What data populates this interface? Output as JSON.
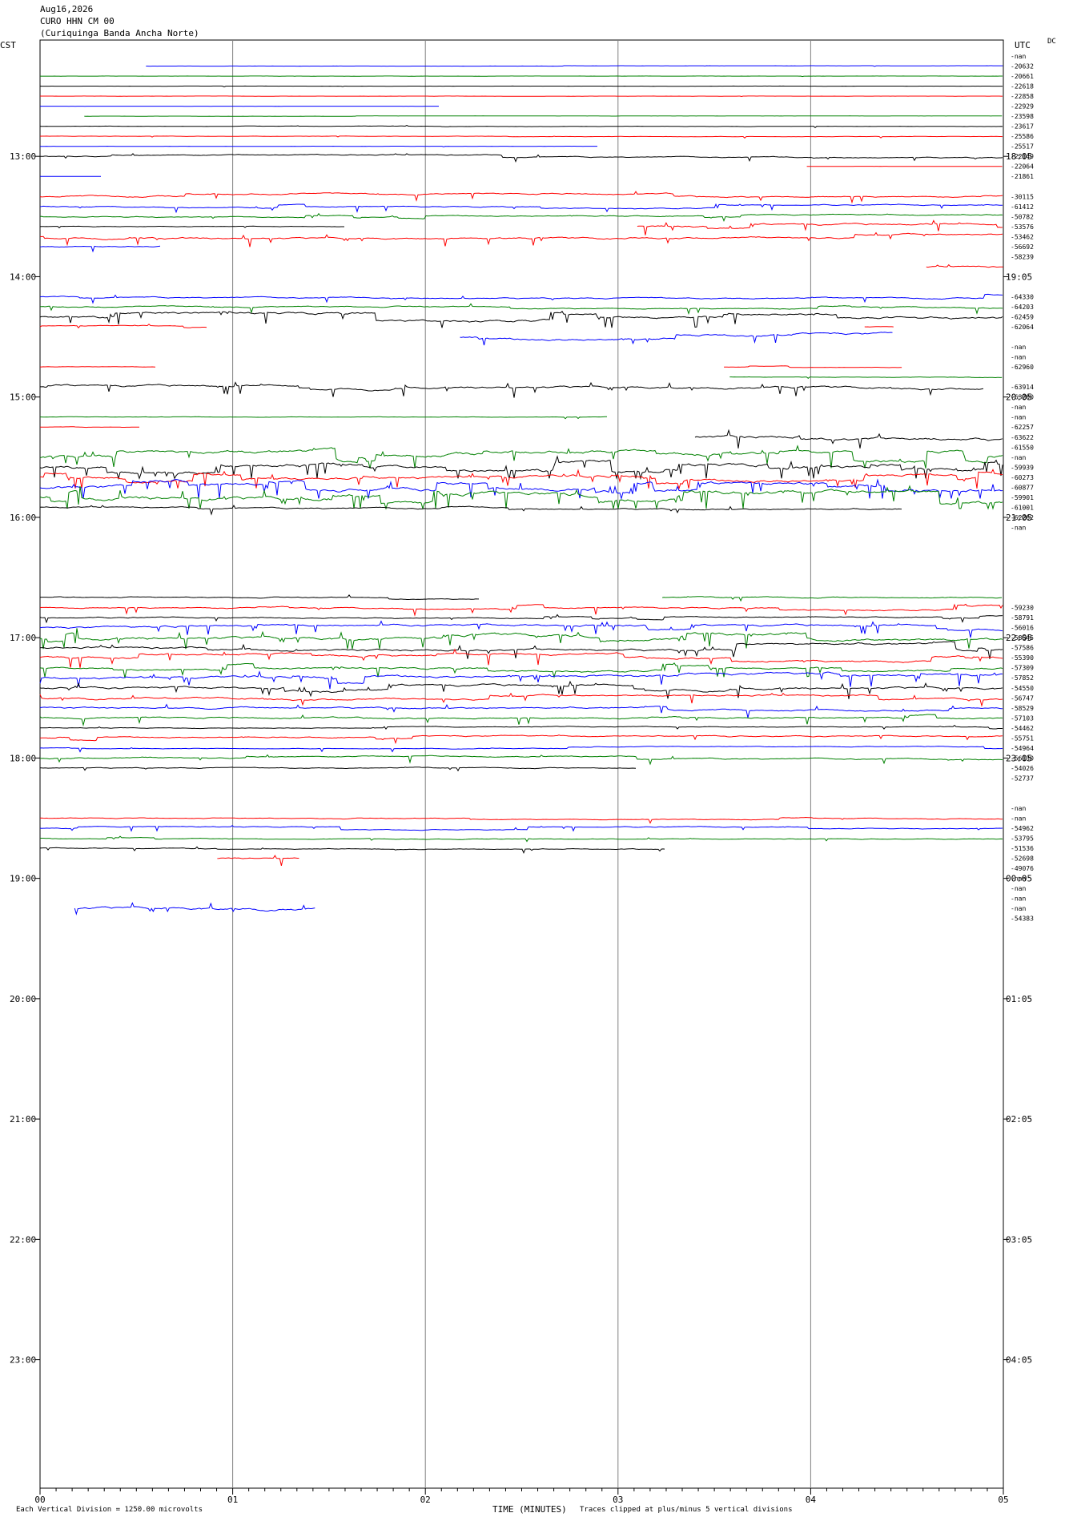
{
  "header": {
    "date": "Aug16,2026",
    "station": "CURO HHN CM 00",
    "site": "(Curiquinga Banda Ancha Norte)"
  },
  "corner_left": "CST",
  "corner_right": "UTC",
  "dc_label": "DC",
  "footer": {
    "x_axis_title": "TIME (MINUTES)",
    "scale_note": "Each Vertical Division = 1250.00 microvolts",
    "clip_note": "Traces clipped at plus/minus 5 vertical divisions"
  },
  "chart_data": {
    "type": "line",
    "title": "",
    "xlabel": "TIME (MINUTES)",
    "xlim": [
      0,
      5
    ],
    "x_ticks": [
      "00",
      "01",
      "02",
      "03",
      "04",
      "05"
    ],
    "left_time_labels": [
      "13:00",
      "14:00",
      "15:00",
      "16:00",
      "17:00",
      "18:00",
      "19:00",
      "20:00",
      "21:00",
      "22:00",
      "23:00"
    ],
    "right_time_labels": [
      "18:05",
      "19:05",
      "20:05",
      "21:05",
      "22:05",
      "23:05",
      "00:05",
      "01:05",
      "02:05",
      "03:05",
      "04:05"
    ],
    "grid": true,
    "trace_colors": [
      "#000000",
      "#ff0000",
      "#0000ff",
      "#008000"
    ],
    "dc_offsets": [
      "-nan",
      "-20632",
      "-20661",
      "-22618",
      "-22858",
      "-22929",
      "-23598",
      "-23617",
      "-25586",
      "-25517",
      "-22149",
      "-22064",
      "-21861",
      "",
      "-30115",
      "-61412",
      "-50782",
      "-53576",
      "-53462",
      "-56692",
      "-58239",
      "",
      "",
      "",
      "-64330",
      "-64203",
      "-62459",
      "-62064",
      "",
      "-nan",
      "-nan",
      "-62960",
      "",
      "-63914",
      "-63200",
      "-nan",
      "-nan",
      "-62257",
      "-63622",
      "-61550",
      "-nan",
      "-59939",
      "-60273",
      "-60877",
      "-59901",
      "-61001",
      "-62262",
      "-nan",
      "",
      "",
      "",
      "",
      "",
      "",
      "",
      "-59230",
      "-58791",
      "-56016",
      "-58545",
      "-57586",
      "-55390",
      "-57309",
      "-57852",
      "-54550",
      "-56747",
      "-58529",
      "-57103",
      "-54462",
      "-55751",
      "-54964",
      "-56130",
      "-54026",
      "-52737",
      "",
      "",
      "-nan",
      "-nan",
      "-54962",
      "-53795",
      "-51536",
      "-52698",
      "-49076",
      "-nan",
      "-nan",
      "-nan",
      "-nan",
      "-54383"
    ],
    "traces": [
      {
        "line": 1,
        "color": "#0000ff",
        "start": 0.55,
        "end": 5.0,
        "level": 0,
        "noise": 0.1
      },
      {
        "line": 2,
        "color": "#008000",
        "start": 0.0,
        "end": 5.0,
        "level": 0,
        "noise": 0.1
      },
      {
        "line": 3,
        "color": "#000000",
        "start": 0.0,
        "end": 5.0,
        "level": 0,
        "noise": 0.1
      },
      {
        "line": 4,
        "color": "#ff0000",
        "start": 0.0,
        "end": 5.0,
        "level": 0,
        "noise": 0.1
      },
      {
        "line": 5,
        "color": "#0000ff",
        "start": 0.0,
        "end": 2.07,
        "level": 0,
        "noise": 0.05
      },
      {
        "line": 6,
        "color": "#008000",
        "start": 0.23,
        "end": 5.0,
        "level": 0,
        "noise": 0.1
      },
      {
        "line": 7,
        "color": "#000000",
        "start": 0.0,
        "end": 5.0,
        "level": 0,
        "noise": 0.2
      },
      {
        "line": 8,
        "color": "#ff0000",
        "start": 0.0,
        "end": 5.0,
        "level": 0,
        "noise": 0.2
      },
      {
        "line": 9,
        "color": "#0000ff",
        "start": 0.0,
        "end": 2.9,
        "level": 0,
        "noise": 0.1
      },
      {
        "line": 10,
        "color": "#000000",
        "start": 0.0,
        "end": 5.0,
        "level": 0,
        "noise": 0.6
      },
      {
        "line": 11,
        "color": "#ff0000",
        "start": 3.98,
        "end": 5.0,
        "level": 0,
        "noise": 0.05
      },
      {
        "line": 12,
        "color": "#0000ff",
        "start": 0.0,
        "end": 0.32,
        "level": 0,
        "noise": 0.05
      },
      {
        "line": 14,
        "color": "#ff0000",
        "start": 0.0,
        "end": 5.0,
        "level": 0,
        "noise": 0.8
      },
      {
        "line": 15,
        "color": "#0000ff",
        "start": 0.0,
        "end": 5.0,
        "level": 0,
        "noise": 0.6
      },
      {
        "line": 16,
        "color": "#008000",
        "start": 0.0,
        "end": 5.0,
        "level": 0,
        "noise": 0.6
      },
      {
        "line": 17,
        "color": "#000000",
        "start": 0.0,
        "end": 1.58,
        "level": 0,
        "noise": 0.3
      },
      {
        "line": 17,
        "color": "#ff0000",
        "start": 3.1,
        "end": 5.0,
        "level": 0,
        "noise": 1.0
      },
      {
        "line": 18,
        "color": "#ff0000",
        "start": 0.0,
        "end": 5.0,
        "level": 0,
        "noise": 0.9
      },
      {
        "line": 19,
        "color": "#0000ff",
        "start": 0.0,
        "end": 0.63,
        "level": 0,
        "noise": 0.6
      },
      {
        "line": 21,
        "color": "#ff0000",
        "start": 4.6,
        "end": 5.0,
        "level": 0,
        "noise": 0.9
      },
      {
        "line": 24,
        "color": "#0000ff",
        "start": 0.0,
        "end": 5.0,
        "level": 0,
        "noise": 0.7
      },
      {
        "line": 25,
        "color": "#008000",
        "start": 0.0,
        "end": 5.0,
        "level": 0,
        "noise": 0.7
      },
      {
        "line": 26,
        "color": "#000000",
        "start": 0.0,
        "end": 5.0,
        "level": 0,
        "noise": 1.3
      },
      {
        "line": 27,
        "color": "#ff0000",
        "start": 0.0,
        "end": 0.87,
        "level": 0,
        "noise": 0.4
      },
      {
        "line": 27,
        "color": "#ff0000",
        "start": 4.28,
        "end": 4.43,
        "level": 0,
        "noise": 0.3
      },
      {
        "line": 28,
        "color": "#0000ff",
        "start": 2.18,
        "end": 4.43,
        "level": 0,
        "noise": 1.2
      },
      {
        "line": 31,
        "color": "#ff0000",
        "start": 0.0,
        "end": 0.6,
        "level": 0,
        "noise": 0.3
      },
      {
        "line": 31,
        "color": "#ff0000",
        "start": 3.55,
        "end": 4.48,
        "level": 0,
        "noise": 0.3
      },
      {
        "line": 32,
        "color": "#008000",
        "start": 3.58,
        "end": 5.0,
        "level": 0,
        "noise": 0.3
      },
      {
        "line": 33,
        "color": "#000000",
        "start": 0.0,
        "end": 4.9,
        "level": 0,
        "noise": 1.1
      },
      {
        "line": 36,
        "color": "#008000",
        "start": 0.0,
        "end": 2.95,
        "level": 0,
        "noise": 0.3
      },
      {
        "line": 37,
        "color": "#ff0000",
        "start": 0.0,
        "end": 0.52,
        "level": 0,
        "noise": 0.3
      },
      {
        "line": 38,
        "color": "#000000",
        "start": 3.4,
        "end": 5.0,
        "level": 0,
        "noise": 1.6
      },
      {
        "line": 40,
        "color": "#008000",
        "start": 0.0,
        "end": 5.0,
        "level": 0,
        "noise": 1.8
      },
      {
        "line": 41,
        "color": "#000000",
        "start": 0.0,
        "end": 5.0,
        "level": 0,
        "noise": 1.8
      },
      {
        "line": 42,
        "color": "#ff0000",
        "start": 0.0,
        "end": 5.0,
        "level": 0,
        "noise": 1.6
      },
      {
        "line": 43,
        "color": "#0000ff",
        "start": 0.0,
        "end": 5.0,
        "level": 0,
        "noise": 1.8
      },
      {
        "line": 44,
        "color": "#008000",
        "start": 0.0,
        "end": 5.0,
        "level": 0,
        "noise": 2.0
      },
      {
        "line": 45,
        "color": "#000000",
        "start": 0.0,
        "end": 4.48,
        "level": 0,
        "noise": 0.8
      },
      {
        "line": 54,
        "color": "#008000",
        "start": 3.23,
        "end": 5.0,
        "level": 0,
        "noise": 0.6
      },
      {
        "line": 54,
        "color": "#000000",
        "start": 0.0,
        "end": 2.28,
        "level": 0,
        "noise": 0.6
      },
      {
        "line": 55,
        "color": "#ff0000",
        "start": 0.0,
        "end": 5.0,
        "level": 0,
        "noise": 0.8
      },
      {
        "line": 56,
        "color": "#000000",
        "start": 0.0,
        "end": 5.0,
        "level": 0,
        "noise": 0.6
      },
      {
        "line": 57,
        "color": "#0000ff",
        "start": 0.0,
        "end": 5.0,
        "level": 0,
        "noise": 1.1
      },
      {
        "line": 58,
        "color": "#008000",
        "start": 0.0,
        "end": 5.0,
        "level": 0,
        "noise": 1.5
      },
      {
        "line": 59,
        "color": "#000000",
        "start": 0.0,
        "end": 5.0,
        "level": 0,
        "noise": 1.2
      },
      {
        "line": 60,
        "color": "#ff0000",
        "start": 0.0,
        "end": 5.0,
        "level": 0,
        "noise": 1.2
      },
      {
        "line": 61,
        "color": "#008000",
        "start": 0.0,
        "end": 5.0,
        "level": 0,
        "noise": 1.1
      },
      {
        "line": 62,
        "color": "#0000ff",
        "start": 0.0,
        "end": 5.0,
        "level": 0,
        "noise": 1.4
      },
      {
        "line": 63,
        "color": "#000000",
        "start": 0.0,
        "end": 5.0,
        "level": 0,
        "noise": 1.2
      },
      {
        "line": 64,
        "color": "#ff0000",
        "start": 0.0,
        "end": 5.0,
        "level": 0,
        "noise": 1.0
      },
      {
        "line": 65,
        "color": "#0000ff",
        "start": 0.0,
        "end": 5.0,
        "level": 0,
        "noise": 0.9
      },
      {
        "line": 66,
        "color": "#008000",
        "start": 0.0,
        "end": 5.0,
        "level": 0,
        "noise": 0.9
      },
      {
        "line": 67,
        "color": "#000000",
        "start": 0.0,
        "end": 5.0,
        "level": 0,
        "noise": 0.4
      },
      {
        "line": 68,
        "color": "#ff0000",
        "start": 0.0,
        "end": 5.0,
        "level": 0,
        "noise": 0.7
      },
      {
        "line": 69,
        "color": "#0000ff",
        "start": 0.0,
        "end": 5.0,
        "level": 0,
        "noise": 0.4
      },
      {
        "line": 70,
        "color": "#008000",
        "start": 0.0,
        "end": 5.0,
        "level": 0,
        "noise": 0.7
      },
      {
        "line": 71,
        "color": "#000000",
        "start": 0.0,
        "end": 3.1,
        "level": 0,
        "noise": 0.5
      },
      {
        "line": 76,
        "color": "#ff0000",
        "start": 0.0,
        "end": 5.0,
        "level": 0,
        "noise": 0.5
      },
      {
        "line": 77,
        "color": "#0000ff",
        "start": 0.0,
        "end": 5.0,
        "level": 0,
        "noise": 0.5
      },
      {
        "line": 78,
        "color": "#008000",
        "start": 0.0,
        "end": 5.0,
        "level": 0,
        "noise": 0.4
      },
      {
        "line": 79,
        "color": "#000000",
        "start": 0.0,
        "end": 3.25,
        "level": 0,
        "noise": 0.5
      },
      {
        "line": 80,
        "color": "#ff0000",
        "start": 0.92,
        "end": 1.35,
        "level": 0,
        "noise": 0.8
      },
      {
        "line": 85,
        "color": "#0000ff",
        "start": 0.18,
        "end": 1.43,
        "level": 0,
        "noise": 1.3
      }
    ]
  }
}
